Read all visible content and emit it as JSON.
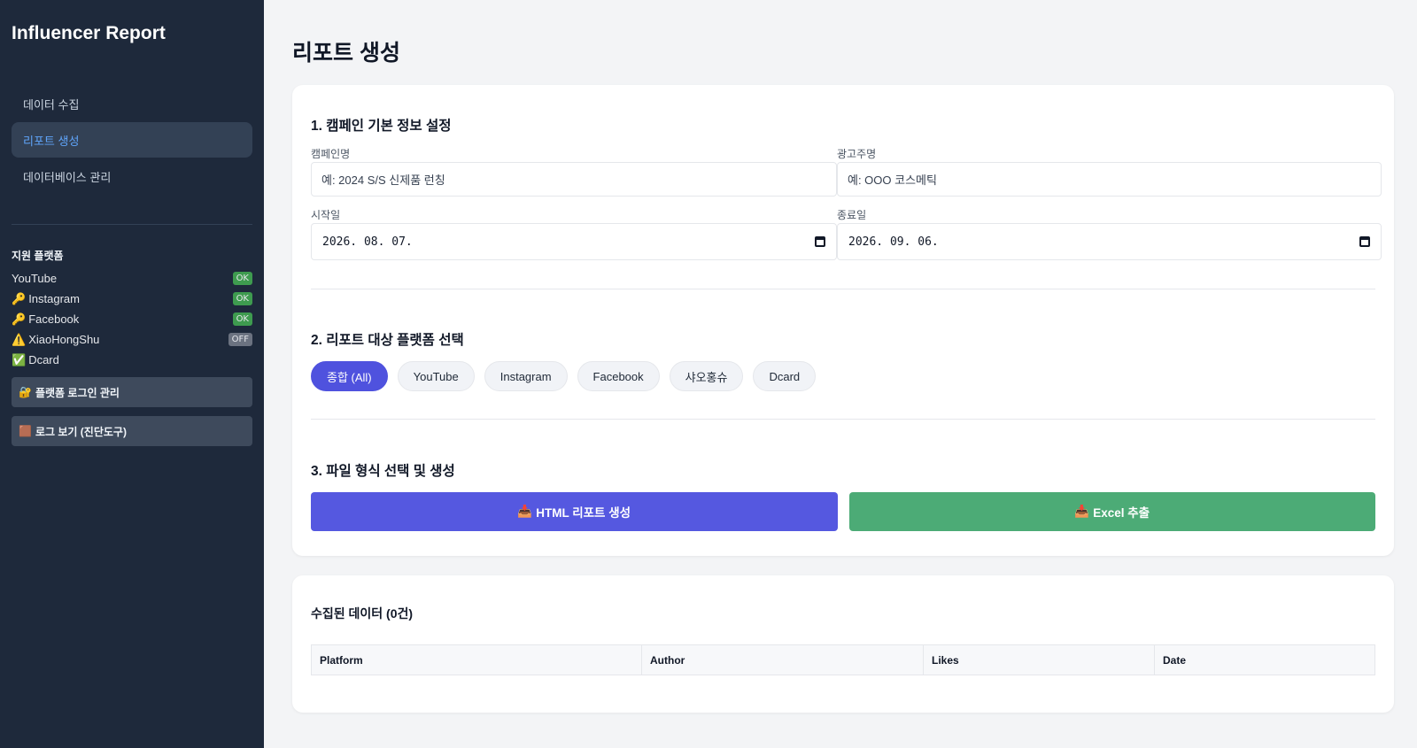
{
  "sidebar": {
    "title": "Influencer Report",
    "nav": [
      {
        "label": "데이터 수집"
      },
      {
        "label": "리포트 생성"
      },
      {
        "label": "데이터베이스 관리"
      }
    ],
    "platforms_heading": "지원 플랫폼",
    "platforms": [
      {
        "prefix": "",
        "name": "YouTube",
        "status": "OK"
      },
      {
        "prefix": "🔑",
        "name": "Instagram",
        "status": "OK"
      },
      {
        "prefix": "🔑",
        "name": "Facebook",
        "status": "OK"
      },
      {
        "prefix": "⚠️",
        "name": "XiaoHongShu",
        "status": "OFF"
      },
      {
        "prefix": "✅",
        "name": "Dcard",
        "status": ""
      }
    ],
    "login_btn": {
      "icon": "🔐",
      "label": "플랫폼 로그인 관리"
    },
    "log_btn": {
      "icon": "🟫",
      "label": "로그 보기 (진단도구)"
    }
  },
  "main": {
    "title": "리포트 생성",
    "section1": {
      "title": "1. 캠페인 기본 정보 설정",
      "campaign_label": "캠페인명",
      "campaign_placeholder": "예: 2024 S/S 신제품 런칭",
      "advertiser_label": "광고주명",
      "advertiser_placeholder": "예: OOO 코스메틱",
      "start_label": "시작일",
      "start_value": "2026. 08. 07.",
      "end_label": "종료일",
      "end_value": "2026. 09. 06."
    },
    "section2": {
      "title": "2. 리포트 대상 플랫폼 선택",
      "chips": [
        "종합 (All)",
        "YouTube",
        "Instagram",
        "Facebook",
        "샤오홍슈",
        "Dcard"
      ]
    },
    "section3": {
      "title": "3. 파일 형식 선택 및 생성",
      "html_btn": {
        "icon": "📥",
        "label": "HTML 리포트 생성"
      },
      "excel_btn": {
        "icon": "📥",
        "label": "Excel 추출"
      }
    },
    "data": {
      "title": "수집된 데이터 (0건)",
      "columns": [
        "Platform",
        "Author",
        "Likes",
        "Date"
      ]
    }
  },
  "colors": {
    "sidebar_bg": "#1e293b",
    "accent": "#5558e0",
    "excel_green": "#4cab76",
    "active_nav_text": "#60a5fa"
  }
}
